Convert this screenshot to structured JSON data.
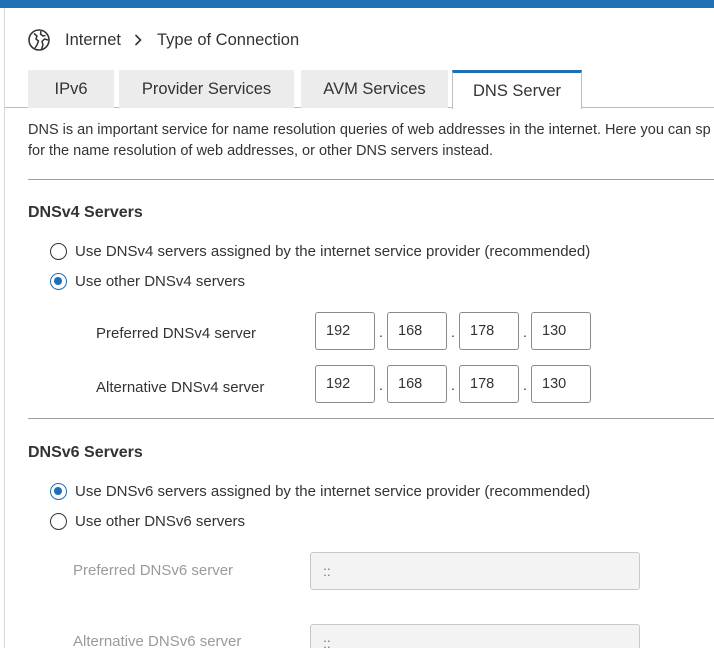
{
  "breadcrumb": {
    "icon": "globe-icon",
    "parent": "Internet",
    "current": "Type of Connection"
  },
  "tabs": [
    {
      "label": "IPv6",
      "active": false
    },
    {
      "label": "Provider Services",
      "active": false
    },
    {
      "label": "AVM Services",
      "active": false
    },
    {
      "label": "DNS Server",
      "active": true
    }
  ],
  "description": {
    "line1": "DNS is an important service for name resolution queries of web addresses in the internet. Here you can sp",
    "line2": "for the name resolution of web addresses, or other DNS servers instead."
  },
  "dnsv4": {
    "heading": "DNSv4 Servers",
    "option_isp": "Use DNSv4 servers assigned by the internet service provider (recommended)",
    "option_other": "Use other DNSv4 servers",
    "selected": "other",
    "preferred_label": "Preferred DNSv4 server",
    "preferred": [
      "192",
      "168",
      "178",
      "130"
    ],
    "alternative_label": "Alternative DNSv4 server",
    "alternative": [
      "192",
      "168",
      "178",
      "130"
    ],
    "separator": "."
  },
  "dnsv6": {
    "heading": "DNSv6 Servers",
    "option_isp": "Use DNSv6 servers assigned by the internet service provider (recommended)",
    "option_other": "Use other DNSv6 servers",
    "selected": "isp",
    "preferred_label": "Preferred DNSv6 server",
    "preferred_placeholder": "::",
    "alternative_label": "Alternative DNSv6 server",
    "alternative_placeholder": "::"
  },
  "colors": {
    "accent": "#1f6fb5",
    "tab_inactive": "#ececec",
    "disabled_text": "#9a9a9a"
  }
}
